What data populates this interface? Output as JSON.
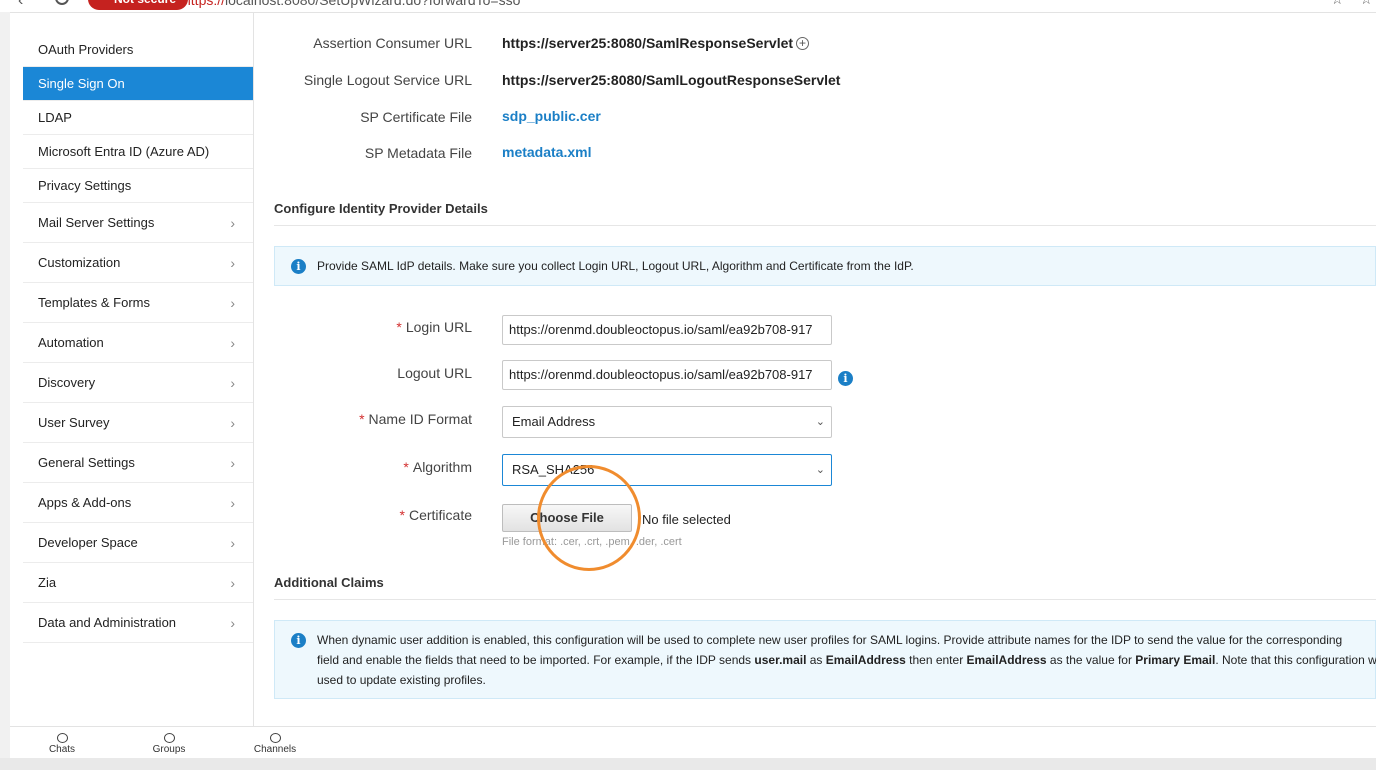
{
  "browser": {
    "not_secure": "Not secure",
    "url_prefix": "https://",
    "url_rest": "localhost:8080/SetUpWizard.do?forwardTo=sso"
  },
  "sidebar": {
    "items": [
      {
        "label": "OAuth Providers",
        "active": false,
        "expandable": false
      },
      {
        "label": "Single Sign On",
        "active": true,
        "expandable": false
      },
      {
        "label": "LDAP",
        "active": false,
        "expandable": false
      },
      {
        "label": "Microsoft Entra ID (Azure AD)",
        "active": false,
        "expandable": false
      },
      {
        "label": "Privacy Settings",
        "active": false,
        "expandable": false
      },
      {
        "label": "Mail Server Settings",
        "active": false,
        "expandable": true
      },
      {
        "label": "Customization",
        "active": false,
        "expandable": true
      },
      {
        "label": "Templates & Forms",
        "active": false,
        "expandable": true
      },
      {
        "label": "Automation",
        "active": false,
        "expandable": true
      },
      {
        "label": "Discovery",
        "active": false,
        "expandable": true
      },
      {
        "label": "User Survey",
        "active": false,
        "expandable": true
      },
      {
        "label": "General Settings",
        "active": false,
        "expandable": true
      },
      {
        "label": "Apps & Add-ons",
        "active": false,
        "expandable": true
      },
      {
        "label": "Developer Space",
        "active": false,
        "expandable": true
      },
      {
        "label": "Zia",
        "active": false,
        "expandable": true
      },
      {
        "label": "Data and Administration",
        "active": false,
        "expandable": true
      }
    ]
  },
  "sp_details": {
    "acs_label": "Assertion Consumer URL",
    "acs_value": "https://server25:8080/SamlResponseServlet",
    "slo_label": "Single Logout Service URL",
    "slo_value": "https://server25:8080/SamlLogoutResponseServlet",
    "cert_label": "SP Certificate File",
    "cert_value": "sdp_public.cer",
    "metadata_label": "SP Metadata File",
    "metadata_value": "metadata.xml"
  },
  "idp": {
    "title": "Configure Identity Provider Details",
    "info": "Provide SAML IdP details. Make sure you collect Login URL, Logout URL, Algorithm and Certificate from the IdP.",
    "login_label": "Login URL",
    "login_value": "https://orenmd.doubleoctopus.io/saml/ea92b708-917",
    "logout_label": "Logout URL",
    "logout_value": "https://orenmd.doubleoctopus.io/saml/ea92b708-917",
    "nameid_label": "Name ID Format",
    "nameid_value": "Email Address",
    "algorithm_label": "Algorithm",
    "algorithm_value": "RSA_SHA256",
    "certificate_label": "Certificate",
    "choose_file": "Choose File",
    "no_file": "No file selected",
    "file_hint": "File format: .cer, .crt, .pem, .der, .cert"
  },
  "claims": {
    "title": "Additional Claims",
    "line1": "When dynamic user addition is enabled, this configuration will be used to complete new user profiles for SAML logins. Provide attribute names for the IDP to send the value for the corresponding",
    "line2_a": "field and enable the fields that need to be imported. For example, if the IDP sends ",
    "line2_b": "user.mail",
    "line2_c": " as ",
    "line2_d": "EmailAddress",
    "line2_e": " then enter ",
    "line2_f": "EmailAddress",
    "line2_g": " as the value for ",
    "line2_h": "Primary Email",
    "line2_i": ". Note that this configuration will not be",
    "line3": "used to update existing profiles."
  },
  "bottom_bar": {
    "chats": "Chats",
    "groups": "Groups",
    "channels": "Channels"
  },
  "colors": {
    "accent": "#1b87d6",
    "link": "#1b7fc6",
    "required": "#d32f2f",
    "highlight": "#f08c2e"
  }
}
